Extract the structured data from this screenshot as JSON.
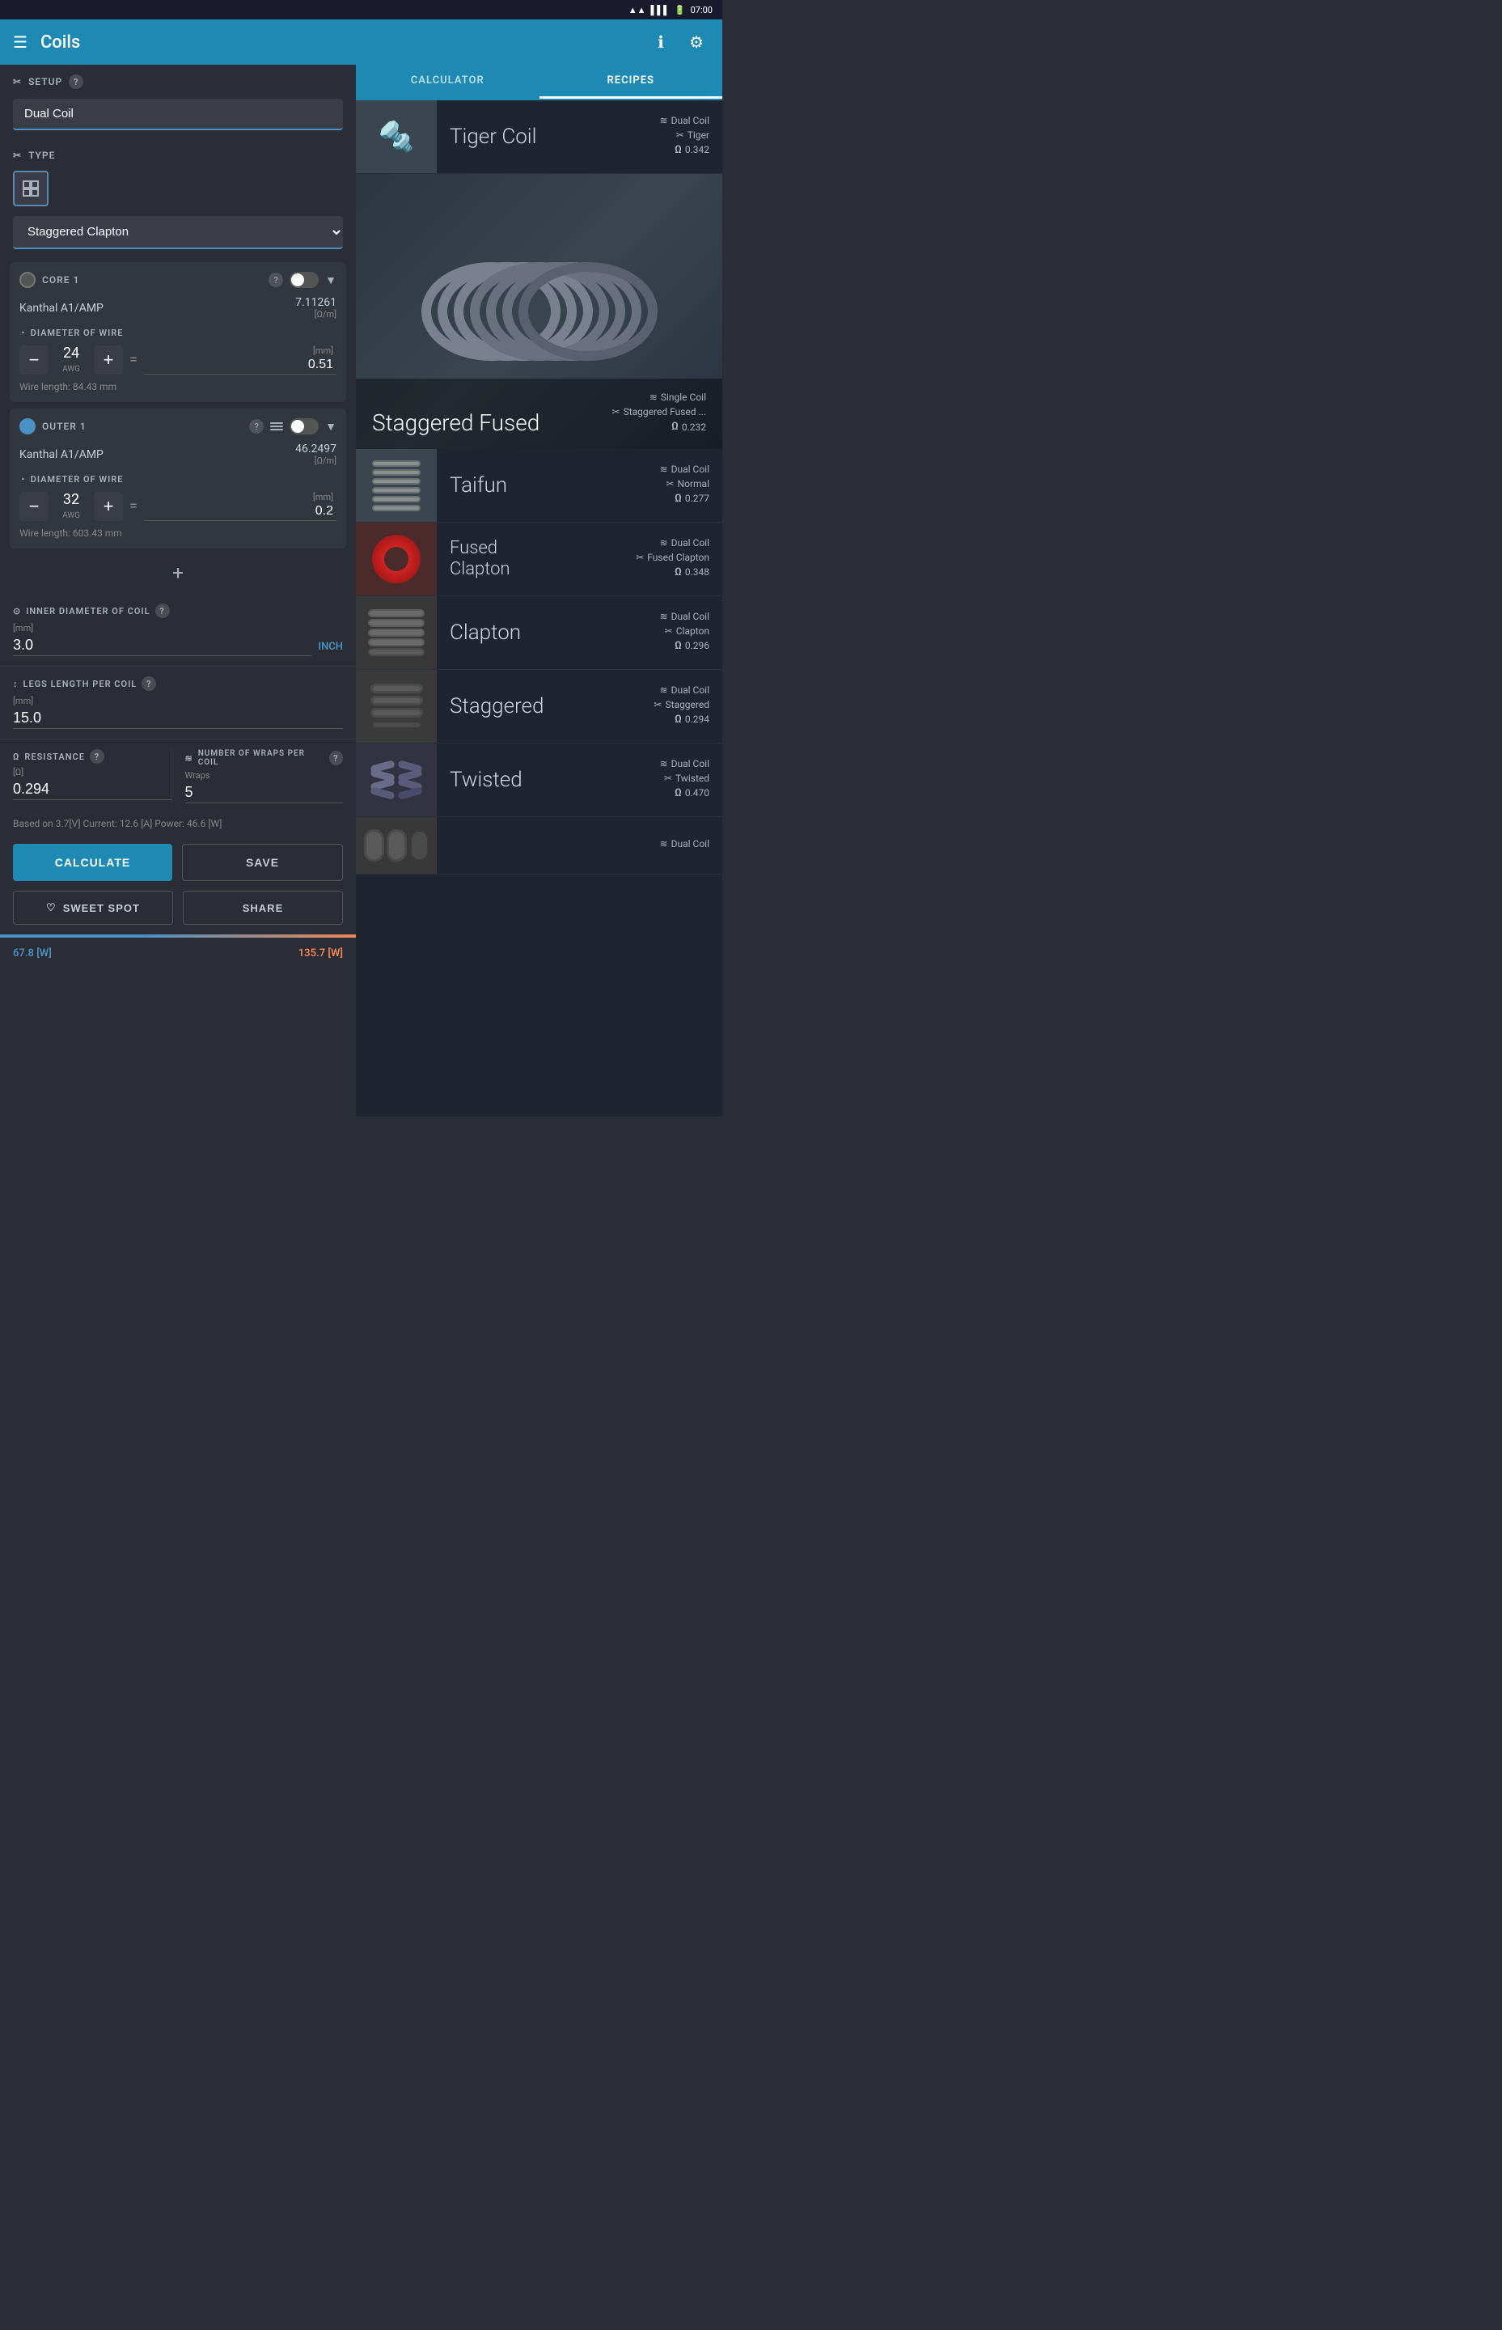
{
  "statusBar": {
    "time": "07:00",
    "wifiIcon": "wifi",
    "signalIcon": "signal",
    "batteryIcon": "battery"
  },
  "appBar": {
    "title": "Coils",
    "menuIcon": "menu",
    "infoIcon": "info",
    "settingsIcon": "settings"
  },
  "tabs": {
    "calculator": "CALCULATOR",
    "recipes": "RECIPES"
  },
  "setup": {
    "sectionLabel": "SETUP",
    "helpIcon": "?",
    "coilType": "Dual Coil",
    "typeSectionLabel": "TYPE",
    "coilStyle": "Staggered Clapton"
  },
  "core1": {
    "label": "CORE 1",
    "helpIcon": "?",
    "material": "Kanthal A1/AMP",
    "resistanceValue": "7.11261",
    "resistanceUnit": "[Ω/m]",
    "diameterLabel": "DIAMETER OF WIRE",
    "awgValue": "24",
    "awgUnit": "AWG",
    "mmUnit": "[mm]",
    "mmValue": "0.51",
    "wireLength": "Wire length: 84.43 mm"
  },
  "outer1": {
    "label": "OUTER 1",
    "helpIcon": "?",
    "material": "Kanthal A1/AMP",
    "resistanceValue": "46.2497",
    "resistanceUnit": "[Ω/m]",
    "diameterLabel": "DIAMETER OF WIRE",
    "awgValue": "32",
    "awgUnit": "AWG",
    "mmUnit": "[mm]",
    "mmValue": "0.2",
    "wireLength": "Wire length: 603.43 mm"
  },
  "addWire": "+",
  "innerDiameter": {
    "label": "INNER DIAMETER OF COIL",
    "helpIcon": "?",
    "unit": "[mm]",
    "value": "3.0",
    "inchLabel": "INCH"
  },
  "legsLength": {
    "label": "LEGS LENGTH PER COIL",
    "helpIcon": "?",
    "unit": "[mm]",
    "value": "15.0"
  },
  "resistance": {
    "label": "RESISTANCE",
    "helpIcon": "?",
    "unit": "[Ω]",
    "value": "0.294"
  },
  "wrapsPerCoil": {
    "label": "NUMBER OF WRAPS PER COIL",
    "helpIcon": "?",
    "unit": "Wraps",
    "value": "5"
  },
  "powerInfo": "Based on 3.7[V]  Current: 12.6 [A]  Power: 46.6 [W]",
  "buttons": {
    "calculate": "CALCULATE",
    "save": "SAVE",
    "sweetSpot": "SWEET SPOT",
    "share": "SHARE"
  },
  "wattBar": {
    "low": "67.8 [W]",
    "high": "135.7 [W]"
  },
  "recipes": [
    {
      "name": "Tiger Coil",
      "coilType": "Dual Coil",
      "wireType": "Tiger",
      "resistance": "0.342",
      "thumbColor": "#3a4550",
      "thumbEmoji": "🔧"
    },
    {
      "name": "Staggered Fused",
      "coilType": "Single Coil",
      "wireType": "Staggered Fused ...",
      "resistance": "0.232",
      "isLarge": true
    },
    {
      "name": "Taifun",
      "coilType": "Dual Coil",
      "wireType": "Normal",
      "resistance": "0.277",
      "thumbColor": "#4a5560",
      "thumbEmoji": "〰"
    },
    {
      "name": "Fused Clapton",
      "coilType": "Dual Coil",
      "wireType": "Fused Clapton",
      "resistance": "0.348",
      "thumbColor": "#5a3535",
      "thumbEmoji": "🔴"
    },
    {
      "name": "Clapton",
      "coilType": "Dual Coil",
      "wireType": "Clapton",
      "resistance": "0.296",
      "thumbColor": "#404040",
      "thumbEmoji": "⚙"
    },
    {
      "name": "Staggered",
      "coilType": "Dual Coil",
      "wireType": "Staggered",
      "resistance": "0.294",
      "thumbColor": "#3a4040",
      "thumbEmoji": "≋"
    },
    {
      "name": "Twisted",
      "coilType": "Dual Coil",
      "wireType": "Twisted",
      "resistance": "0.470",
      "thumbColor": "#3a3a4a",
      "thumbEmoji": "🌀"
    }
  ],
  "icons": {
    "menu": "☰",
    "info": "ℹ",
    "settings": "⚙",
    "coilSetup": "✂",
    "type": "✂",
    "diameterIcon": "◔",
    "resistanceIcon": "Ω",
    "wrapsIcon": "≋",
    "innerDiameterIcon": "⊙",
    "legsIcon": "↕",
    "heartIcon": "♡",
    "shareIcon": "⤴"
  }
}
